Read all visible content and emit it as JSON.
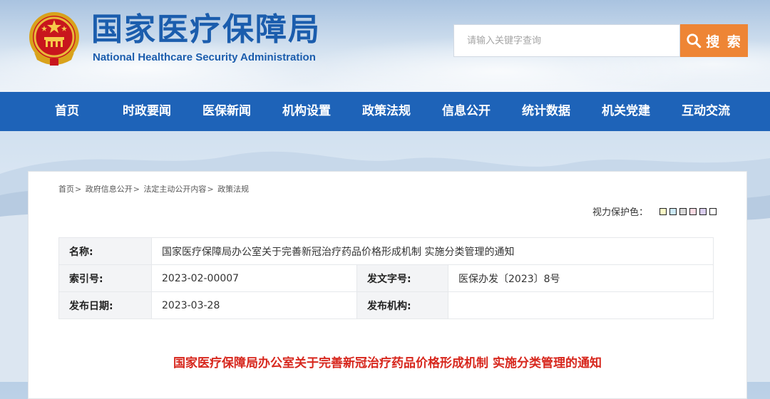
{
  "header": {
    "title": "国家医疗保障局",
    "subtitle": "National Healthcare Security Administration",
    "emblem_icon": "national-emblem-icon"
  },
  "search": {
    "placeholder": "请输入关键字查询",
    "button_label": "搜 索",
    "button_icon": "search-icon",
    "button_color": "#ee8535"
  },
  "nav": {
    "color": "#1e63b8",
    "items": [
      {
        "label": "首页"
      },
      {
        "label": "时政要闻"
      },
      {
        "label": "医保新闻"
      },
      {
        "label": "机构设置"
      },
      {
        "label": "政策法规"
      },
      {
        "label": "信息公开"
      },
      {
        "label": "统计数据"
      },
      {
        "label": "机关党建"
      },
      {
        "label": "互动交流"
      }
    ]
  },
  "breadcrumb": {
    "items": [
      "首页",
      "政府信息公开",
      "法定主动公开内容",
      "政策法规"
    ],
    "separator": ">"
  },
  "eye_protection": {
    "label": "视力保护色：",
    "swatches": [
      "#faf7c6",
      "#cbe8f6",
      "#d7d7d7",
      "#f7d9e1",
      "#d9cdee",
      "#ffffff"
    ]
  },
  "info": {
    "name_label": "名称:",
    "name_value": "国家医疗保障局办公室关于完善新冠治疗药品价格形成机制 实施分类管理的通知",
    "index_label": "索引号:",
    "index_value": "2023-02-00007",
    "doc_no_label": "发文字号:",
    "doc_no_value": "医保办发〔2023〕8号",
    "date_label": "发布日期:",
    "date_value": "2023-03-28",
    "issuer_label": "发布机构:",
    "issuer_value": ""
  },
  "notice": {
    "title": "国家医疗保障局办公室关于完善新冠治疗药品价格形成机制 实施分类管理的通知",
    "title_color": "#d7271d"
  }
}
